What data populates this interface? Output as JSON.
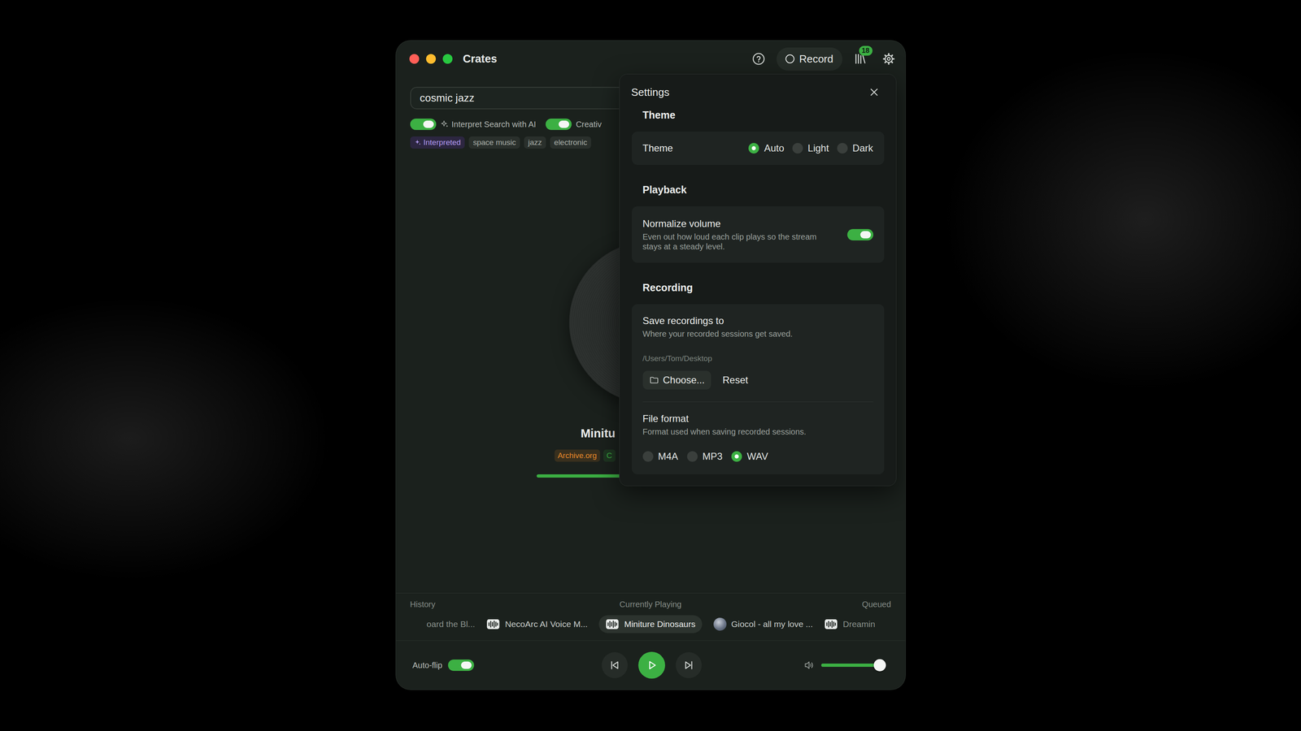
{
  "window": {
    "title": "Crates",
    "traffic_lights": [
      {
        "color": "#ff5f57"
      },
      {
        "color": "#febc2e"
      },
      {
        "color": "#28c840"
      }
    ]
  },
  "toolbar": {
    "record_label": "Record",
    "recording": false,
    "library_badge": "18"
  },
  "search": {
    "value": "cosmic jazz"
  },
  "toggles": [
    {
      "label": "Interpret Search with AI",
      "on": true,
      "kind": "ai"
    },
    {
      "label": "Creativ",
      "on": true,
      "kind": "plain"
    }
  ],
  "tags": [
    {
      "label": "Interpreted",
      "kind": "interpreted"
    },
    {
      "label": "space music",
      "kind": "term"
    },
    {
      "label": "jazz",
      "kind": "term"
    },
    {
      "label": "electronic",
      "kind": "term"
    }
  ],
  "now_playing": {
    "title": "Minitu",
    "sources": [
      {
        "label": "Archive.org",
        "color": "#e8892a"
      },
      {
        "label": "C",
        "color": "#3cb043"
      }
    ],
    "progress": {
      "level": 0.4
    }
  },
  "timeline": {
    "labels": {
      "history": "History",
      "current": "Currently Playing",
      "queued": "Queued"
    },
    "history": [
      {
        "title": "oard the Bl...",
        "kind": "none"
      },
      {
        "title": "NecoArc AI Voice M...",
        "kind": "wave"
      }
    ],
    "current": {
      "title": "Miniture Dinosaurs",
      "kind": "wave"
    },
    "queued": [
      {
        "title": "Giocol - all my love ...",
        "kind": "art"
      },
      {
        "title": "Dreamin",
        "kind": "wave"
      }
    ]
  },
  "controls": {
    "auto_flip": {
      "label": "Auto-flip",
      "on": true
    },
    "playing": false,
    "volume": {
      "level": 0.9
    }
  },
  "settings": {
    "title": "Settings",
    "sections": [
      {
        "heading": "Theme",
        "rows": [
          {
            "kind": "inline-radio",
            "label": "Theme",
            "options": [
              {
                "label": "Auto",
                "selected": true
              },
              {
                "label": "Light",
                "selected": false
              },
              {
                "label": "Dark",
                "selected": false
              }
            ]
          }
        ]
      },
      {
        "heading": "Playback",
        "rows": [
          {
            "kind": "toggle",
            "label": "Normalize volume",
            "description": "Even out how loud each clip plays so the stream stays at a steady level.",
            "on": true
          }
        ]
      },
      {
        "heading": "Recording",
        "rows": [
          {
            "kind": "folder",
            "label": "Save recordings to",
            "description": "Where your recorded sessions get saved.",
            "path": "/Users/Tom/Desktop",
            "buttons": [
              "Choose...",
              "Reset"
            ]
          },
          {
            "kind": "stacked-radio",
            "label": "File format",
            "description": "Format used when saving recorded sessions.",
            "options": [
              {
                "label": "M4A",
                "selected": false
              },
              {
                "label": "MP3",
                "selected": false
              },
              {
                "label": "WAV",
                "selected": true
              }
            ]
          }
        ]
      }
    ]
  }
}
